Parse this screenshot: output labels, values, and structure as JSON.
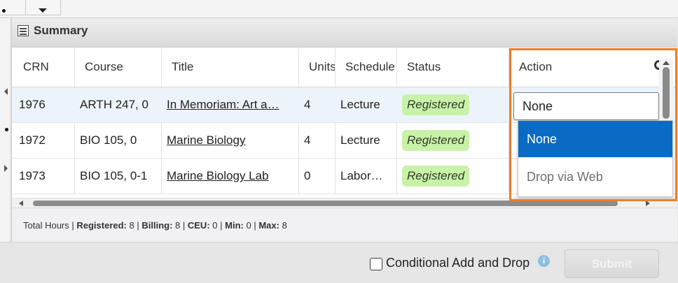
{
  "summary": {
    "title": "Summary",
    "columns": [
      "CRN",
      "Course",
      "Title",
      "Units",
      "Schedule",
      "Status",
      "Action"
    ],
    "rows": [
      {
        "crn": "1976",
        "course": "ARTH 247, 0",
        "title": "In Memoriam: Art a…",
        "units": "4",
        "schedule": "Lecture",
        "status": "Registered"
      },
      {
        "crn": "1972",
        "course": "BIO 105, 0",
        "title": "Marine Biology",
        "units": "4",
        "schedule": "Lecture",
        "status": "Registered"
      },
      {
        "crn": "1973",
        "course": "BIO 105, 0-1",
        "title": "Marine Biology Lab",
        "units": "0",
        "schedule": "Labor…",
        "status": "Registered"
      }
    ]
  },
  "action_dropdown": {
    "selected": "None",
    "options": [
      "None",
      "Drop via Web"
    ]
  },
  "totals": {
    "label": "Total Hours",
    "registered_label": "Registered:",
    "registered": "8",
    "billing_label": "Billing:",
    "billing": "8",
    "ceu_label": "CEU:",
    "ceu": "0",
    "min_label": "Min:",
    "min": "0",
    "max_label": "Max:",
    "max": "8"
  },
  "footer": {
    "conditional_label": "Conditional Add and Drop",
    "info_icon": "i",
    "submit_label": "Submit"
  },
  "colors": {
    "highlight": "#f07d25",
    "selected_option": "#0b6bc4",
    "status_badge": "#c8f2a8"
  }
}
